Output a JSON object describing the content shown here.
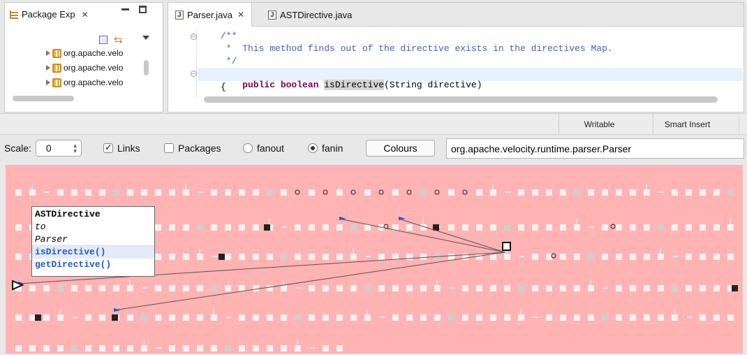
{
  "package_explorer": {
    "title": "Package Exp",
    "items": [
      "org.apache.velo",
      "org.apache.velo",
      "org.apache.velo"
    ]
  },
  "editor": {
    "tabs": [
      {
        "label": "Parser.java"
      },
      {
        "label": "ASTDirective.java"
      }
    ],
    "code": {
      "l1": "/**",
      "l2": " *  This method finds out of the directive exists in the directives Map.",
      "l3": " */",
      "l4_kw": "public boolean ",
      "l4_name": "isDirective",
      "l4_rest": "(String directive)",
      "l5": "{"
    }
  },
  "statusbar": {
    "writable": "Writable",
    "insert": "Smart Insert"
  },
  "toolbar": {
    "scale_label": "Scale:",
    "scale_value": "0",
    "links_label": "Links",
    "links_checked": true,
    "packages_label": "Packages",
    "packages_checked": false,
    "fanout_label": "fanout",
    "fanin_label": "fanin",
    "fanin_selected": true,
    "colours_label": "Colours",
    "class_name": "org.apache.velocity.runtime.parser.Parser"
  },
  "tooltip": {
    "from": "ASTDirective",
    "to_word": "to",
    "target": "Parser",
    "methods": [
      "isDirective()",
      "getDirective()"
    ]
  },
  "colors": {
    "canvas_bg": "#ffb3b3",
    "link_blue": "#1f57d6",
    "comment": "#3f5fbf",
    "keyword": "#7f0055"
  }
}
